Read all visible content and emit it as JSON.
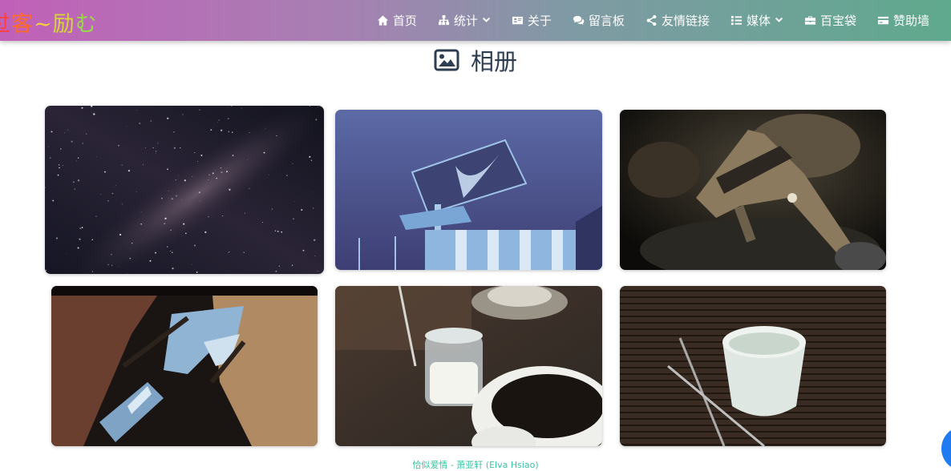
{
  "header": {
    "logo_chars": [
      "过",
      "客",
      "~",
      "励",
      "む"
    ],
    "logo_colors": [
      "#ff4040",
      "#ff6a2a",
      "#f2d13a",
      "#d6d43a",
      "#9ad94a"
    ],
    "nav": [
      {
        "label": "首页",
        "icon": "home-icon",
        "dropdown": false
      },
      {
        "label": "统计",
        "icon": "sitemap-icon",
        "dropdown": true
      },
      {
        "label": "关于",
        "icon": "id-card-icon",
        "dropdown": false
      },
      {
        "label": "留言板",
        "icon": "comments-icon",
        "dropdown": false
      },
      {
        "label": "友情链接",
        "icon": "share-icon",
        "dropdown": false
      },
      {
        "label": "媒体",
        "icon": "list-icon",
        "dropdown": true
      },
      {
        "label": "百宝袋",
        "icon": "toolbox-icon",
        "dropdown": false
      },
      {
        "label": "赞助墙",
        "icon": "credit-card-icon",
        "dropdown": false
      }
    ]
  },
  "page": {
    "title": "相册",
    "title_icon": "image-icon"
  },
  "album": {
    "photos": [
      {
        "name": "milky-way-night-sky"
      },
      {
        "name": "billboard-blue-tone"
      },
      {
        "name": "rifle-and-helmet"
      },
      {
        "name": "building-looking-up"
      },
      {
        "name": "coffee-and-milk-jar"
      },
      {
        "name": "cup-with-chopsticks"
      }
    ]
  },
  "footer": {
    "now_playing": "恰似爱情 - 萧亚轩 (Elva Hsiao)"
  }
}
